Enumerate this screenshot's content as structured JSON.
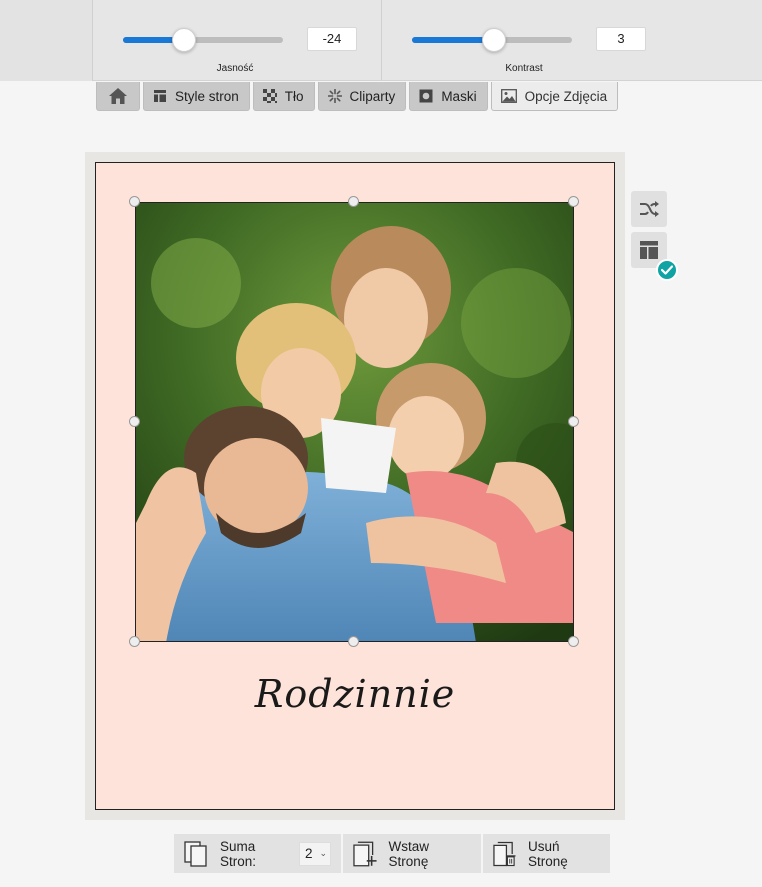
{
  "sliders": {
    "brightness": {
      "label": "Jasność",
      "value": "-24",
      "level": 0.38
    },
    "contrast": {
      "label": "Kontrast",
      "value": "3",
      "level": 0.51
    }
  },
  "tabs": [
    {
      "label": "",
      "icon": "home-icon"
    },
    {
      "label": "Style stron",
      "icon": "layout-icon"
    },
    {
      "label": "Tło",
      "icon": "checker-icon"
    },
    {
      "label": "Cliparty",
      "icon": "sparkle-icon"
    },
    {
      "label": "Maski",
      "icon": "mask-icon"
    },
    {
      "label": "Opcje Zdjęcia",
      "icon": "image-icon",
      "active": true
    }
  ],
  "page": {
    "caption": "Rodzinnie",
    "background": "#fde3d9"
  },
  "side_buttons": [
    {
      "icon": "shuffle-icon"
    },
    {
      "icon": "layout-grid-icon"
    }
  ],
  "bottom_bar": {
    "page_count_label": "Suma Stron:",
    "page_count_value": "2",
    "insert_label": "Wstaw Stronę",
    "delete_label": "Usuń Stronę"
  },
  "colors": {
    "accent": "#1a78d6",
    "badge": "#0fa3a3"
  }
}
